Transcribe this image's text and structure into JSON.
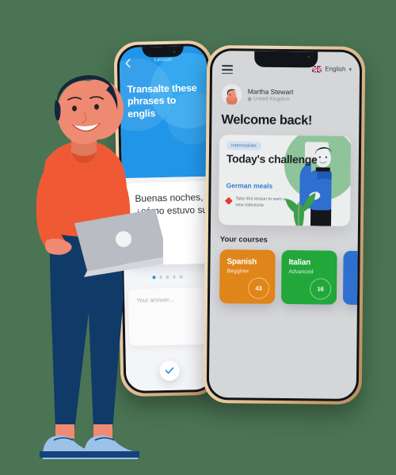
{
  "background_color": "#4a7453",
  "left_phone": {
    "name": "lesson-screen",
    "back_icon": "chevron-left-icon",
    "header_title": "Lesson",
    "question": "Transalte these phrases to englis",
    "phrase": "Buenas noches, ¿cómo estuvo su día?",
    "pagination": {
      "total": 5,
      "active_index": 0
    },
    "answer_placeholder": "Your answer...",
    "submit_icon": "check-icon",
    "accent_color": "#2196e8"
  },
  "right_phone": {
    "name": "home-screen",
    "menu_icon": "hamburger-icon",
    "language": {
      "label": "English",
      "flag": "uk-flag-icon",
      "chevron": "chevron-down-icon"
    },
    "user": {
      "name": "Martha Stewart",
      "location": "United Kingdom",
      "location_icon": "map-pin-icon",
      "avatar": "user-avatar"
    },
    "welcome": "Welcome back!",
    "challenge": {
      "badge": "Intermediate",
      "title": "Today's challenge",
      "subtitle": "German meals",
      "note": "Take this lesson to earn a new milestone",
      "note_icon": "diamond-icon",
      "subtitle_color": "#2f7ed8",
      "art_color": "#8fc49b"
    },
    "courses_heading": "Your courses",
    "courses": [
      {
        "name": "Spanish",
        "level": "Begginer",
        "progress": "43",
        "color": "#e08519"
      },
      {
        "name": "Italian",
        "level": "Advanced",
        "progress": "16",
        "color": "#22a73b"
      },
      {
        "name": "",
        "level": "",
        "progress": "",
        "color": "#2f6fd0"
      }
    ]
  },
  "illustration": {
    "name": "man-with-laptop",
    "shirt_color": "#ef5a34",
    "pants_color": "#103a68",
    "skin_color": "#f08a73",
    "hair_color": "#16263a",
    "laptop_color": "#b9bcc2",
    "shoe_color": "#9dc2e8"
  }
}
